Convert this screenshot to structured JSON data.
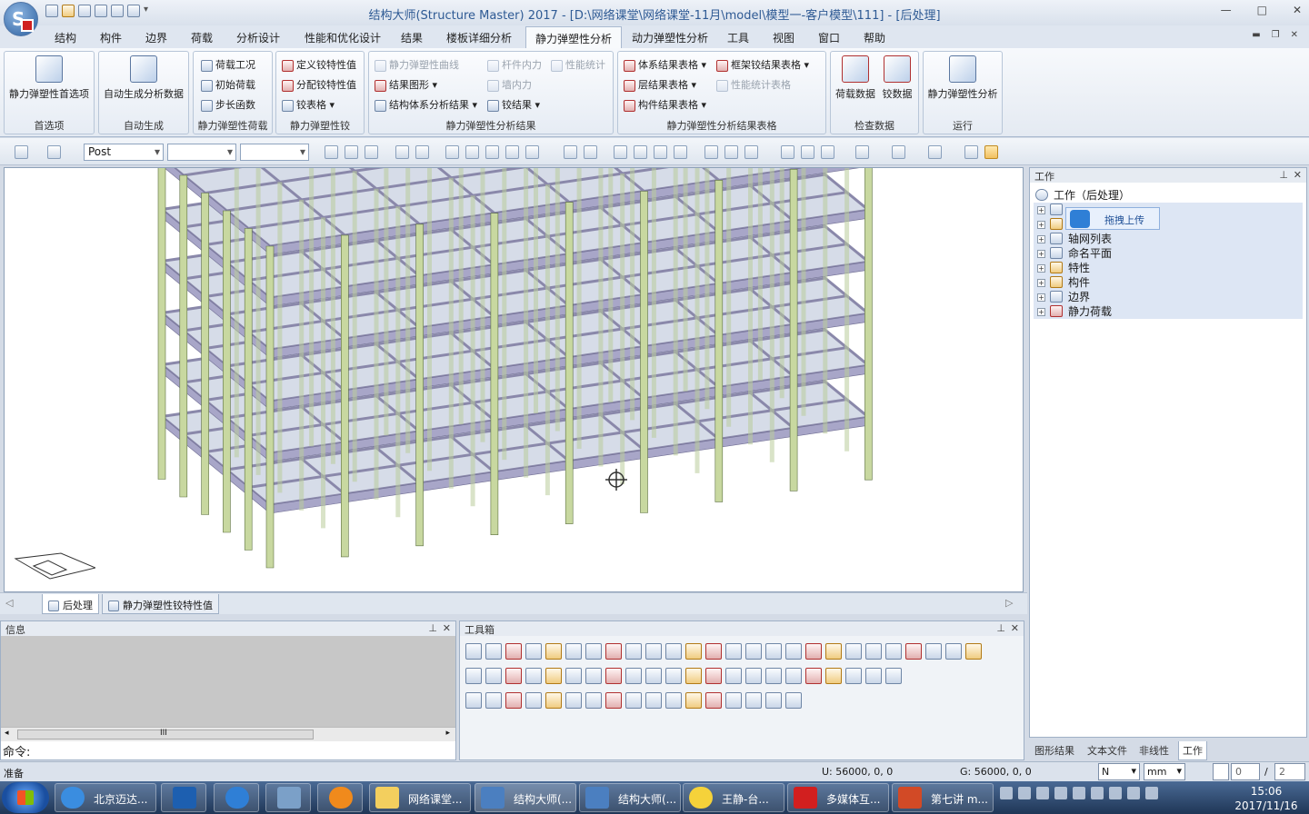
{
  "window": {
    "title": "结构大师(Structure Master) 2017 - [D:\\网络课堂\\网络课堂-11月\\model\\模型一-客户模型\\111] - [后处理]",
    "min": "—",
    "max": "□",
    "close": "✕"
  },
  "ribbon_tabs": [
    {
      "label": "结构"
    },
    {
      "label": "构件"
    },
    {
      "label": "边界"
    },
    {
      "label": "荷载"
    },
    {
      "label": "分析设计"
    },
    {
      "label": "性能和优化设计"
    },
    {
      "label": "结果"
    },
    {
      "label": "楼板详细分析"
    },
    {
      "label": "静力弹塑性分析"
    },
    {
      "label": "动力弹塑性分析"
    },
    {
      "label": "工具"
    },
    {
      "label": "视图"
    },
    {
      "label": "窗口"
    },
    {
      "label": "帮助"
    }
  ],
  "ribbon": {
    "g1": {
      "label": "首选项",
      "btn": "静力弹塑性首选项"
    },
    "g2": {
      "label": "自动生成",
      "btn": "自动生成分析数据"
    },
    "g3": {
      "label": "静力弹塑性荷载",
      "items": [
        "荷载工况",
        "初始荷载",
        "步长函数"
      ]
    },
    "g4": {
      "label": "静力弹塑性铰",
      "items": [
        "定义铰特性值",
        "分配铰特性值",
        "铰表格"
      ]
    },
    "g5": {
      "label": "静力弹塑性分析结果",
      "items": [
        "静力弹塑性曲线",
        "结果图形",
        "结构体系分析结果",
        "杆件内力",
        "墙内力",
        "铰结果",
        "性能统计"
      ]
    },
    "g6": {
      "label": "静力弹塑性分析结果表格",
      "items": [
        "体系结果表格",
        "层结果表格",
        "构件结果表格",
        "框架铰结果表格",
        "性能统计表格"
      ]
    },
    "g7": {
      "label": "检查数据",
      "btns": [
        "荷载数据",
        "铰数据"
      ]
    },
    "g8": {
      "label": "运行",
      "btn": "静力弹塑性分析"
    }
  },
  "toolbar": {
    "combo_value": "Post"
  },
  "doc_tabs": [
    "后处理",
    "静力弹塑性铰特性值"
  ],
  "work_panel": {
    "title": "工作",
    "tree": [
      {
        "label": "工作（后处理）"
      },
      {
        "label": ""
      },
      {
        "label": ""
      },
      {
        "label": "轴网列表"
      },
      {
        "label": "命名平面"
      },
      {
        "label": "特性"
      },
      {
        "label": "构件"
      },
      {
        "label": "边界"
      },
      {
        "label": "静力荷载"
      }
    ],
    "upload_popup": "拖拽上传",
    "tabs": [
      "图形结果",
      "文本文件",
      "非线性",
      "工作"
    ]
  },
  "info_panel": {
    "title": "信息",
    "scroll_grip": "III",
    "command_label": "命令:"
  },
  "toolbox": {
    "title": "工具箱"
  },
  "status": {
    "ready": "准备",
    "u_coord": "U: 56000, 0, 0",
    "g_coord": "G: 56000, 0, 0",
    "force_unit": "N",
    "length_unit": "mm",
    "page_current": "0",
    "page_sep": "/",
    "page_total": "2"
  },
  "taskbar": {
    "items": [
      {
        "label": "北京迈达..."
      },
      {
        "label": "网络课堂..."
      },
      {
        "label": "结构大师(..."
      },
      {
        "label": "结构大师(..."
      },
      {
        "label": "王静-台..."
      },
      {
        "label": "多媒体互..."
      },
      {
        "label": "第七讲 m..."
      }
    ],
    "time": "15:06",
    "date": "2017/11/16"
  },
  "colors": {
    "accent": "#2e5a94",
    "column": "#c8d8a0",
    "beam": "#a8a6c8",
    "slab": "#d6dce8"
  }
}
